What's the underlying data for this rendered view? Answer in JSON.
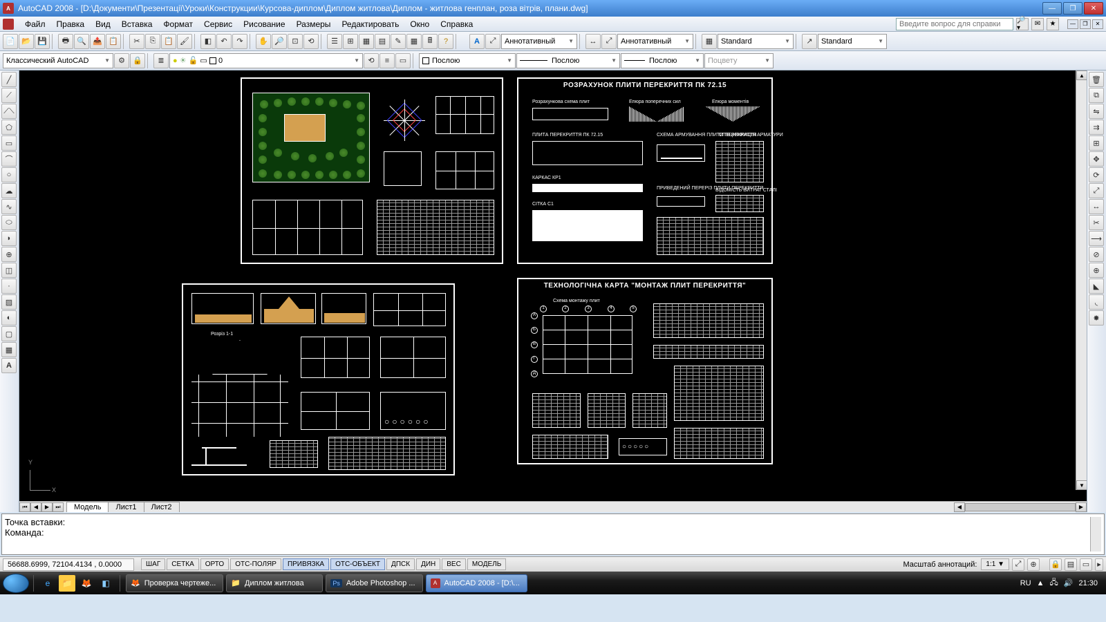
{
  "title": "AutoCAD 2008 - [D:\\Документи\\Презентації\\Уроки\\Конструкции\\Курсова-диплом\\Диплом житлова\\Диплом - житлова генплан, роза вітрів, плани.dwg]",
  "menu": [
    "Файл",
    "Правка",
    "Вид",
    "Вставка",
    "Формат",
    "Сервис",
    "Рисование",
    "Размеры",
    "Редактировать",
    "Окно",
    "Справка"
  ],
  "help_placeholder": "Введите вопрос для справки",
  "workspace_sel": "Классический AutoCAD",
  "layer_sel": "0",
  "annot1": "Аннотативный",
  "annot2": "Аннотативный",
  "textstyle": "Standard",
  "dimstyle": "Standard",
  "linetype": "Послою",
  "color": "Послою",
  "lineweight": "Послою",
  "plotstyle": "Поцвету",
  "tabs": {
    "model": "Модель",
    "l1": "Лист1",
    "l2": "Лист2"
  },
  "cmd": {
    "line1": "Точка вставки:",
    "line2": "Команда:"
  },
  "coords": "56688.6999, 72104.4134 , 0.0000",
  "status_btns": [
    "ШАГ",
    "СЕТКА",
    "ОРТО",
    "ОТС-ПОЛЯР",
    "ПРИВЯЗКА",
    "ОТС-ОБЪЕКТ",
    "ДПСК",
    "ДИН",
    "ВЕС",
    "МОДЕЛЬ"
  ],
  "status_on": [
    4,
    5
  ],
  "annoscale_label": "Масштаб аннотаций:",
  "annoscale_val": "1:1",
  "sheets": {
    "s2_title": "РОЗРАХУНОК ПЛИТИ ПЕРЕКРИТТЯ ПК 72.15",
    "s2_l1": "Розрахункова схема плит",
    "s2_l2": "Епюра поперечних сил",
    "s2_l3": "Епюра моментів",
    "s2_l4": "ПЛИТА ПЕРЕКРИТТЯ ПК 72.15",
    "s2_l5": "СХЕМА АРМУВАННЯ ПЛИТИ ПЕРЕКРИТТЯ",
    "s2_l6": "СПЕЦИФІКАЦІЯ АРМАТУРИ",
    "s2_l7": "КАРКАС КР1",
    "s2_l8": "ПРИВЕДЕНИЙ ПЕРЕРІЗ ПЛИТИ ПЕРЕКРИТТЯ",
    "s2_l9": "ВІДОМІСТЬ ВИТРАТ СТАЛІ",
    "s2_l10": "СІТКА С1",
    "s3_rozr": "Розріз 1-1",
    "s4_title": "ТЕХНОЛОГІЧНА КАРТА  \"МОНТАЖ ПЛИТ ПЕРЕКРИТТЯ\"",
    "s4_l1": "Схема монтажу плит"
  },
  "task": {
    "t1": "Проверка чертеже...",
    "t2": "Диплом житлова",
    "t3": "Adobe Photoshop ...",
    "t4": "AutoCAD 2008 - [D:\\..."
  },
  "lang": "RU",
  "clock": "21:30"
}
